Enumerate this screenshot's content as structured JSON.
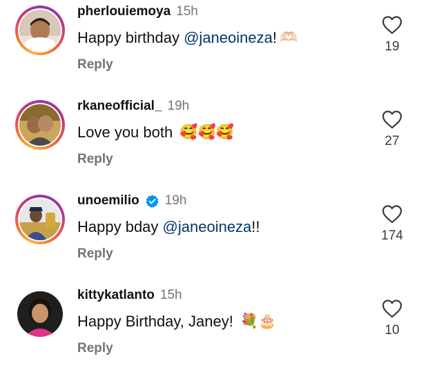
{
  "colors": {
    "mention": "#00376b",
    "muted": "#737373",
    "verified": "#0095f6"
  },
  "comments": [
    {
      "username": "pherlouiemoya",
      "time": "15h",
      "verified": false,
      "text_before": "Happy birthday ",
      "mention": "@janeoineza",
      "text_after": "!",
      "emoji": "🫶🏻",
      "reply_label": "Reply",
      "likes": "19",
      "heart_icon": "heart-outline-icon"
    },
    {
      "username": "rkaneofficial_",
      "time": "19h",
      "verified": false,
      "text_before": "Love you both ",
      "mention": "",
      "text_after": "",
      "emoji": "🥰🥰🥰",
      "reply_label": "Reply",
      "likes": "27",
      "heart_icon": "heart-outline-icon"
    },
    {
      "username": "unoemilio",
      "time": "19h",
      "verified": true,
      "text_before": "Happy bday ",
      "mention": "@janeoineza",
      "text_after": "!!",
      "emoji": "",
      "reply_label": "Reply",
      "likes": "174",
      "heart_icon": "heart-outline-icon"
    },
    {
      "username": "kittykatlanto",
      "time": "15h",
      "verified": false,
      "text_before": "Happy Birthday, Janey! ",
      "mention": "",
      "text_after": "",
      "emoji": "💐🎂",
      "reply_label": "Reply",
      "likes": "10",
      "heart_icon": "heart-outline-icon"
    }
  ]
}
